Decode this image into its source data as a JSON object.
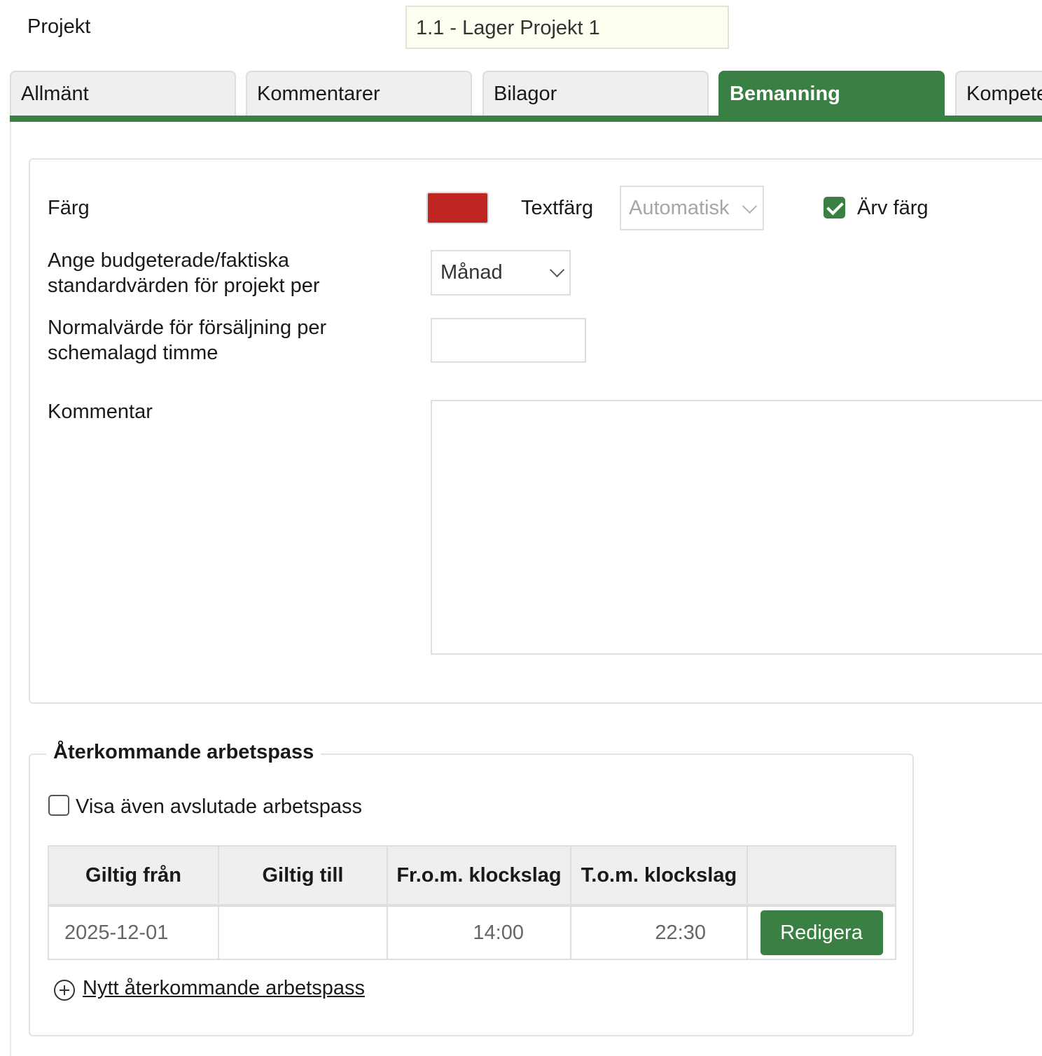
{
  "project": {
    "label": "Projekt",
    "value": "1.1 - Lager Projekt 1"
  },
  "tabs": [
    {
      "label": "Allmänt",
      "active": false
    },
    {
      "label": "Kommentarer",
      "active": false
    },
    {
      "label": "Bilagor",
      "active": false
    },
    {
      "label": "Bemanning",
      "active": true
    },
    {
      "label": "Kompetens",
      "active": false
    }
  ],
  "settings": {
    "color_label": "Färg",
    "color_value": "#c02621",
    "text_color_label": "Textfärg",
    "text_color_value": "Automatisk",
    "inherit_color_label": "Ärv färg",
    "inherit_color_checked": true,
    "budget_label": "Ange budgeterade/faktiska standardvärden för projekt per",
    "budget_value": "Månad",
    "sales_label": "Normalvärde för försäljning per schemalagd timme",
    "sales_value": "",
    "comment_label": "Kommentar",
    "comment_value": ""
  },
  "recurring": {
    "title": "Återkommande arbetspass",
    "show_finished_label": "Visa även avslutade arbetspass",
    "show_finished_checked": false,
    "columns": [
      "Giltig från",
      "Giltig till",
      "Fr.o.m. klockslag",
      "T.o.m. klockslag",
      ""
    ],
    "rows": [
      {
        "valid_from": "2025-12-01",
        "valid_to": "",
        "from_time": "14:00",
        "to_time": "22:30",
        "action": "Redigera"
      }
    ],
    "new_link": "Nytt återkommande arbetspass"
  },
  "colors": {
    "accent": "#3a8043",
    "swatch": "#c02621",
    "project_field_bg": "#fefff0"
  }
}
